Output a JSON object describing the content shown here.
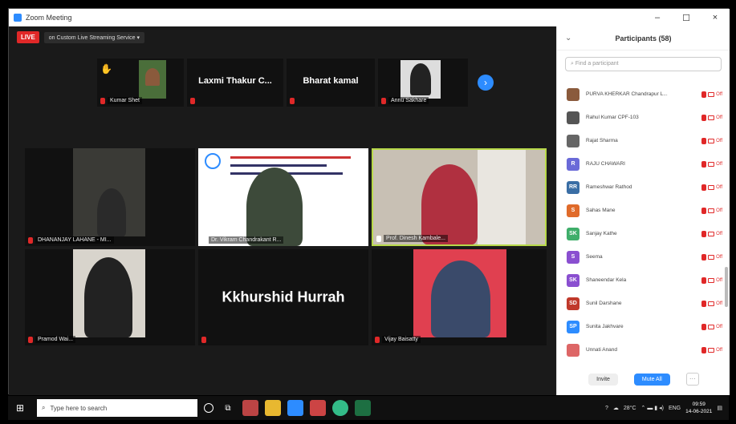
{
  "window": {
    "title": "Zoom Meeting",
    "controls": [
      "–",
      "☐",
      "×"
    ]
  },
  "live": {
    "badge": "LIVE",
    "session": "on Custom Live Streaming Service ▾"
  },
  "strip": {
    "tiles": [
      {
        "name": "",
        "label": "Kumar Shet"
      },
      {
        "name": "Laxmi Thakur C...",
        "label": ""
      },
      {
        "name": "Bharat kamal",
        "label": ""
      },
      {
        "name": "",
        "label": "Annu Sakhare"
      }
    ],
    "next_icon": "chevron-right-icon"
  },
  "grid": {
    "tiles": [
      {
        "label": "DHANANJAY LAHANE - MI..."
      },
      {
        "label": "Dr. Vikram Chandrakant R..."
      },
      {
        "label": "Prof. Dinesh Kambale..."
      },
      {
        "label": "Pramod Wai..."
      },
      {
        "name": "Kkhurshid Hurrah",
        "label": ""
      },
      {
        "label": "Vijay Baisatty"
      }
    ]
  },
  "panel": {
    "title": "Participants (58)",
    "search_placeholder": "Find a participant",
    "participants": [
      {
        "name": "PURVA KHERKAR Chandrapur L...",
        "avatar": "",
        "color": "#8a5a3c"
      },
      {
        "name": "Rahul Kumar CPF-103",
        "avatar": "",
        "color": "#555555"
      },
      {
        "name": "Rajat Sharma",
        "avatar": "",
        "color": "#666666"
      },
      {
        "name": "RAJU CHAWARI",
        "avatar": "R",
        "color": "#6a6ad8"
      },
      {
        "name": "Rameshwar Rathod",
        "avatar": "RR",
        "color": "#3a6ea5"
      },
      {
        "name": "Sahas Mane",
        "avatar": "S",
        "color": "#e06b2a"
      },
      {
        "name": "Sanjay Kathe",
        "avatar": "SK",
        "color": "#3fae6a"
      },
      {
        "name": "Seema",
        "avatar": "S",
        "color": "#8a4fd0"
      },
      {
        "name": "Shaneendar Kela",
        "avatar": "SK",
        "color": "#8a4fd0"
      },
      {
        "name": "Sunil Darshane",
        "avatar": "SD",
        "color": "#c0392b"
      },
      {
        "name": "Sunita Jakhvare",
        "avatar": "SP",
        "color": "#2d8cff"
      },
      {
        "name": "Unnati Anand",
        "avatar": "",
        "color": "#d66"
      }
    ],
    "mute_label": "Off",
    "footer": {
      "invite": "Invite",
      "mute_all": "Mute All",
      "more": "···"
    }
  },
  "taskbar": {
    "search_placeholder": "Type here to search",
    "weather": "28°C",
    "clock_time": "09:59",
    "clock_date": "14-06-2021",
    "lang": "ENG"
  }
}
